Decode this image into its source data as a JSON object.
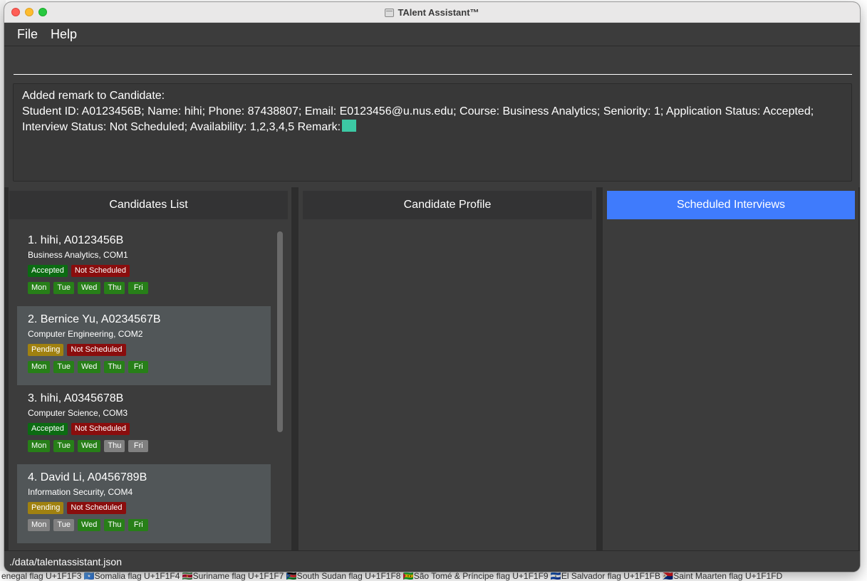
{
  "window": {
    "title": "TAlent Assistant™"
  },
  "menu": {
    "file": "File",
    "help": "Help"
  },
  "command": {
    "value": ""
  },
  "result": {
    "line1": "Added remark to Candidate:",
    "line2": "Student ID: A0123456B; Name: hihi; Phone: 87438807; Email: E0123456@u.nus.edu; Course: Business Analytics; Seniority: 1; Application Status: Accepted;",
    "line3": "Interview Status: Not Scheduled; Availability: 1,2,3,4,5 Remark:"
  },
  "panes": {
    "candidates": "Candidates List",
    "profile": "Candidate Profile",
    "interviews": "Scheduled Interviews"
  },
  "candidates": [
    {
      "title": "1.  hihi, A0123456B",
      "course": "Business Analytics, COM1",
      "app_status": "Accepted",
      "interview_status": "Not Scheduled",
      "days": [
        {
          "label": "Mon",
          "available": true
        },
        {
          "label": "Tue",
          "available": true
        },
        {
          "label": "Wed",
          "available": true
        },
        {
          "label": "Thu",
          "available": true
        },
        {
          "label": "Fri",
          "available": true
        }
      ]
    },
    {
      "title": "2.  Bernice Yu, A0234567B",
      "course": "Computer Engineering, COM2",
      "app_status": "Pending",
      "interview_status": "Not Scheduled",
      "days": [
        {
          "label": "Mon",
          "available": true
        },
        {
          "label": "Tue",
          "available": true
        },
        {
          "label": "Wed",
          "available": true
        },
        {
          "label": "Thu",
          "available": true
        },
        {
          "label": "Fri",
          "available": true
        }
      ]
    },
    {
      "title": "3.  hihi, A0345678B",
      "course": "Computer Science, COM3",
      "app_status": "Accepted",
      "interview_status": "Not Scheduled",
      "days": [
        {
          "label": "Mon",
          "available": true
        },
        {
          "label": "Tue",
          "available": true
        },
        {
          "label": "Wed",
          "available": true
        },
        {
          "label": "Thu",
          "available": false
        },
        {
          "label": "Fri",
          "available": false
        }
      ]
    },
    {
      "title": "4.  David Li, A0456789B",
      "course": "Information Security, COM4",
      "app_status": "Pending",
      "interview_status": "Not Scheduled",
      "days": [
        {
          "label": "Mon",
          "available": false
        },
        {
          "label": "Tue",
          "available": false
        },
        {
          "label": "Wed",
          "available": true
        },
        {
          "label": "Thu",
          "available": true
        },
        {
          "label": "Fri",
          "available": true
        }
      ]
    }
  ],
  "status_bar": {
    "path": "./data/talentassistant.json"
  },
  "background_strip": "enegal flag U+1F1F3 🇸🇴Somalia flag U+1F1F4 🇸🇷Suriname flag U+1F1F7 🇸🇸South Sudan flag U+1F1F8 🇸🇹São Tomé & Príncipe flag U+1F1F9 🇸🇻El Salvador flag U+1F1FB 🇸🇽Saint Maarten flag U+1F1FD",
  "colors": {
    "accent_tab": "#3f7bfc",
    "accepted": "#0b6b12",
    "pending": "#a08110",
    "not_scheduled": "#8a0d0d",
    "day_available": "#277f18",
    "day_unavailable": "#808080",
    "remark_swatch": "#3cc9a4"
  }
}
